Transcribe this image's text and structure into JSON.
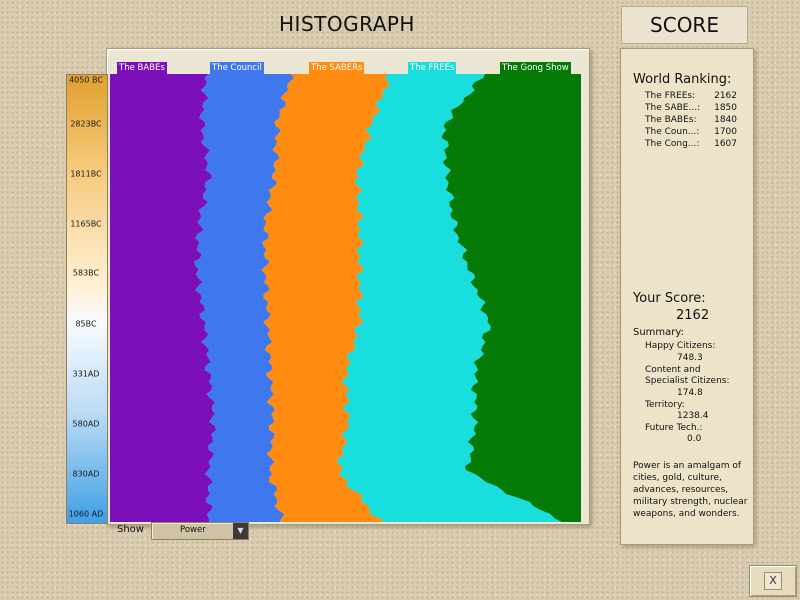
{
  "header": {
    "title": "HISTOGRAPH",
    "score_tab": "SCORE"
  },
  "civs": [
    {
      "name": "The BABEs",
      "color": "#7c10b8"
    },
    {
      "name": "The Council",
      "color": "#3f78ee"
    },
    {
      "name": "The SABERs",
      "color": "#ff8c10"
    },
    {
      "name": "The FREEs",
      "color": "#18dede"
    },
    {
      "name": "The Gong Show",
      "color": "#067a06"
    }
  ],
  "time_axis": [
    "4050 BC",
    "2823BC",
    "1811BC",
    "1165BC",
    "583BC",
    "85BC",
    "331AD",
    "580AD",
    "830AD",
    "1060 AD"
  ],
  "show": {
    "label": "Show",
    "selected": "Power"
  },
  "ranking": {
    "title": "World Ranking:",
    "rows": [
      {
        "name": "The FREEs:",
        "score": "2162"
      },
      {
        "name": "The SABE...:",
        "score": "1850"
      },
      {
        "name": "The BABEs:",
        "score": "1840"
      },
      {
        "name": "The Coun...:",
        "score": "1700"
      },
      {
        "name": "The Cong...:",
        "score": "1607"
      }
    ]
  },
  "your_score": {
    "title": "Your Score:",
    "value": "2162",
    "summary_label": "Summary:",
    "happy_label": "Happy Citizens:",
    "happy_value": "748.3",
    "content_label_1": "Content and",
    "content_label_2": "Specialist Citizens:",
    "content_value": "174.8",
    "territory_label": "Territory:",
    "territory_value": "1238.4",
    "future_label": "Future Tech.:",
    "future_value": "0.0"
  },
  "description": "Power is an amalgam of cities, gold, culture, advances, resources, military strength, nuclear weapons, and wonders.",
  "close_label": "X",
  "chart_data": {
    "type": "area",
    "stacked": true,
    "normalized": true,
    "orientation": "horizontal-stack, time runs top to bottom",
    "metric": "Power",
    "time_labels": [
      "4050 BC",
      "2823BC",
      "1811BC",
      "1165BC",
      "583BC",
      "85BC",
      "331AD",
      "580AD",
      "830AD",
      "1060 AD"
    ],
    "series": [
      {
        "name": "The BABEs",
        "values": [
          0.205,
          0.195,
          0.21,
          0.19,
          0.185,
          0.2,
          0.21,
          0.22,
          0.21,
          0.21
        ]
      },
      {
        "name": "The Council",
        "values": [
          0.18,
          0.16,
          0.14,
          0.14,
          0.145,
          0.135,
          0.13,
          0.125,
          0.13,
          0.155
        ]
      },
      {
        "name": "The SABERs",
        "values": [
          0.21,
          0.2,
          0.175,
          0.2,
          0.2,
          0.195,
          0.16,
          0.16,
          0.145,
          0.21
        ]
      },
      {
        "name": "The FREEs",
        "values": [
          0.2,
          0.155,
          0.19,
          0.2,
          0.235,
          0.275,
          0.275,
          0.27,
          0.275,
          0.39
        ]
      },
      {
        "name": "The Gong Show",
        "values": [
          0.205,
          0.29,
          0.285,
          0.27,
          0.235,
          0.195,
          0.225,
          0.225,
          0.24,
          0.035
        ]
      }
    ]
  }
}
